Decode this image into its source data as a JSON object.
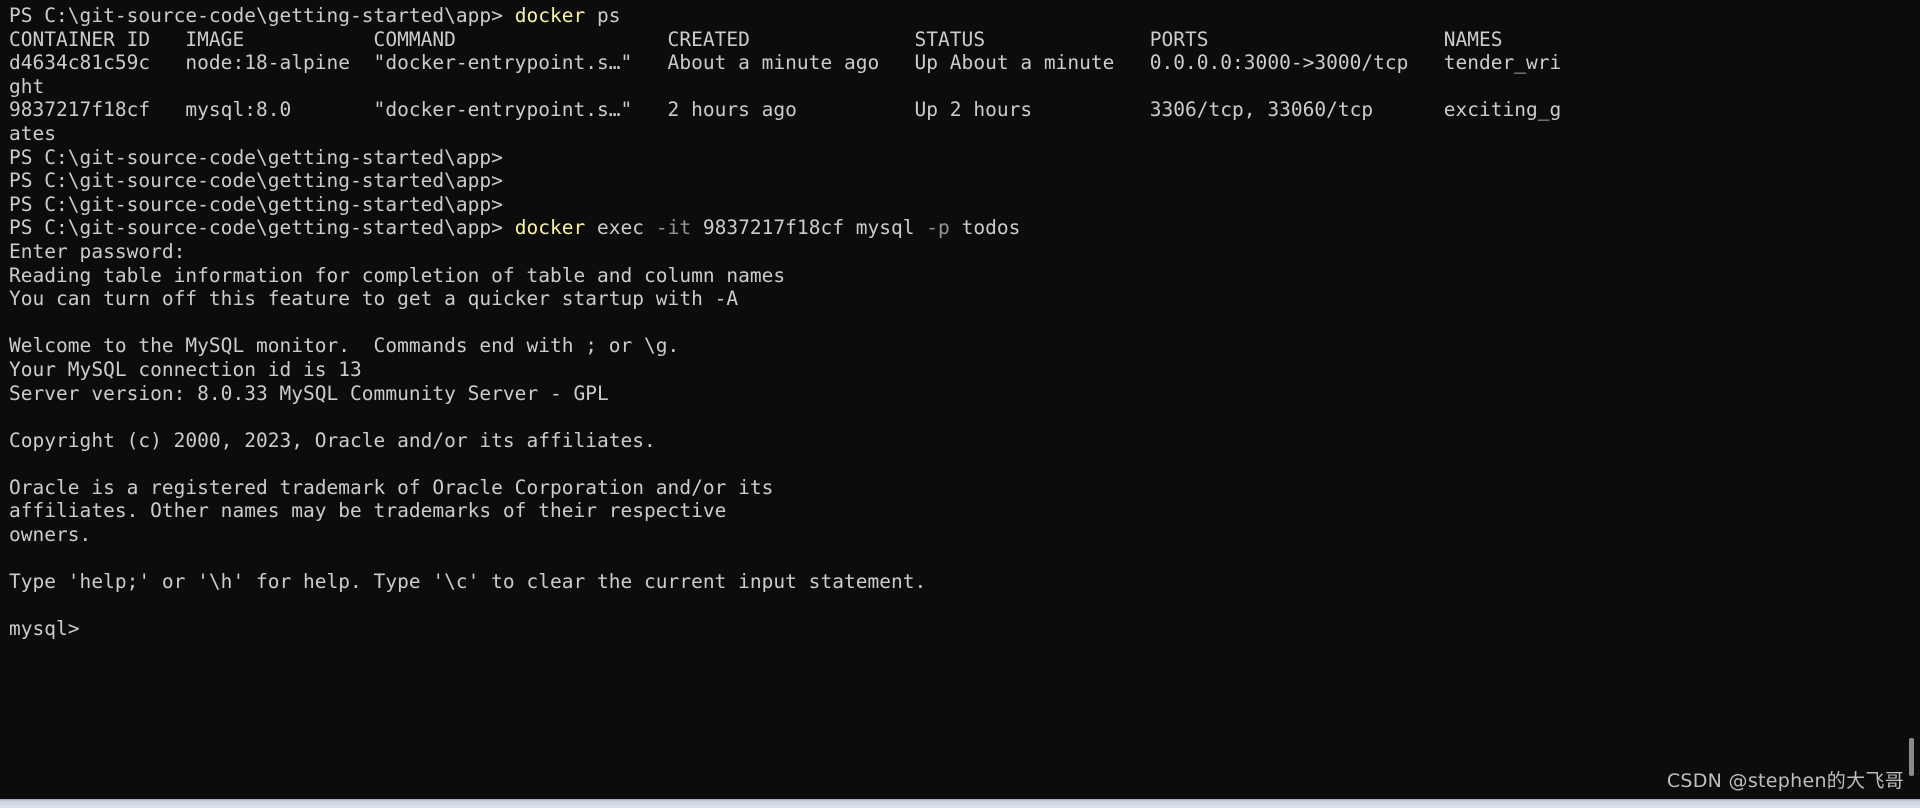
{
  "terminal": {
    "shell": "PowerShell",
    "prompt": "PS C:\\git-source-code\\getting-started\\app>",
    "background_color": "#0c0c0c",
    "foreground_color": "#cccccc",
    "command_color": "#f9f1a5",
    "parameter_color": "#949494",
    "cursor_line": "mysql>",
    "lines": [
      {
        "id": "line-01-prompt-docker-ps",
        "segments": [
          {
            "text": "PS C:\\git-source-code\\getting-started\\app> ",
            "style": "plain"
          },
          {
            "text": "docker",
            "style": "cmd"
          },
          {
            "text": " ps",
            "style": "plain"
          }
        ]
      },
      {
        "id": "line-02-ps-table-header",
        "segments": [
          {
            "text": "CONTAINER ID   IMAGE           COMMAND                  CREATED              STATUS              PORTS                    NAMES",
            "style": "plain"
          }
        ]
      },
      {
        "id": "line-03-ps-row-1",
        "segments": [
          {
            "text": "d4634c81c59c   node:18-alpine  \"docker-entrypoint.s…\"   About a minute ago   Up About a minute   0.0.0.0:3000->3000/tcp   tender_wri",
            "style": "plain"
          }
        ]
      },
      {
        "id": "line-04-ps-row-1-wrap",
        "segments": [
          {
            "text": "ght",
            "style": "plain"
          }
        ]
      },
      {
        "id": "line-05-ps-row-2",
        "segments": [
          {
            "text": "9837217f18cf   mysql:8.0       \"docker-entrypoint.s…\"   2 hours ago          Up 2 hours          3306/tcp, 33060/tcp      exciting_g",
            "style": "plain"
          }
        ]
      },
      {
        "id": "line-06-ps-row-2-wrap",
        "segments": [
          {
            "text": "ates",
            "style": "plain"
          }
        ]
      },
      {
        "id": "line-07-empty-prompt-1",
        "segments": [
          {
            "text": "PS C:\\git-source-code\\getting-started\\app>",
            "style": "plain"
          }
        ]
      },
      {
        "id": "line-08-empty-prompt-2",
        "segments": [
          {
            "text": "PS C:\\git-source-code\\getting-started\\app>",
            "style": "plain"
          }
        ]
      },
      {
        "id": "line-09-empty-prompt-3",
        "segments": [
          {
            "text": "PS C:\\git-source-code\\getting-started\\app>",
            "style": "plain"
          }
        ]
      },
      {
        "id": "line-10-prompt-docker-exec",
        "segments": [
          {
            "text": "PS C:\\git-source-code\\getting-started\\app> ",
            "style": "plain"
          },
          {
            "text": "docker",
            "style": "cmd"
          },
          {
            "text": " exec ",
            "style": "plain"
          },
          {
            "text": "-it",
            "style": "param"
          },
          {
            "text": " 9837217f18cf mysql ",
            "style": "plain"
          },
          {
            "text": "-p",
            "style": "param"
          },
          {
            "text": " todos",
            "style": "plain"
          }
        ]
      },
      {
        "id": "line-11-enter-password",
        "segments": [
          {
            "text": "Enter password:",
            "style": "plain"
          }
        ]
      },
      {
        "id": "line-12-reading-table-info",
        "segments": [
          {
            "text": "Reading table information for completion of table and column names",
            "style": "plain"
          }
        ]
      },
      {
        "id": "line-13-turn-off-feature",
        "segments": [
          {
            "text": "You can turn off this feature to get a quicker startup with -A",
            "style": "plain"
          }
        ]
      },
      {
        "id": "line-14-blank",
        "segments": [
          {
            "text": "",
            "style": "plain"
          }
        ]
      },
      {
        "id": "line-15-welcome",
        "segments": [
          {
            "text": "Welcome to the MySQL monitor.  Commands end with ; or \\g.",
            "style": "plain"
          }
        ]
      },
      {
        "id": "line-16-connection-id",
        "segments": [
          {
            "text": "Your MySQL connection id is 13",
            "style": "plain"
          }
        ]
      },
      {
        "id": "line-17-server-version",
        "segments": [
          {
            "text": "Server version: 8.0.33 MySQL Community Server - GPL",
            "style": "plain"
          }
        ]
      },
      {
        "id": "line-18-blank",
        "segments": [
          {
            "text": "",
            "style": "plain"
          }
        ]
      },
      {
        "id": "line-19-copyright",
        "segments": [
          {
            "text": "Copyright (c) 2000, 2023, Oracle and/or its affiliates.",
            "style": "plain"
          }
        ]
      },
      {
        "id": "line-20-blank",
        "segments": [
          {
            "text": "",
            "style": "plain"
          }
        ]
      },
      {
        "id": "line-21-trademark-1",
        "segments": [
          {
            "text": "Oracle is a registered trademark of Oracle Corporation and/or its",
            "style": "plain"
          }
        ]
      },
      {
        "id": "line-22-trademark-2",
        "segments": [
          {
            "text": "affiliates. Other names may be trademarks of their respective",
            "style": "plain"
          }
        ]
      },
      {
        "id": "line-23-trademark-3",
        "segments": [
          {
            "text": "owners.",
            "style": "plain"
          }
        ]
      },
      {
        "id": "line-24-blank",
        "segments": [
          {
            "text": "",
            "style": "plain"
          }
        ]
      },
      {
        "id": "line-25-help-hint",
        "segments": [
          {
            "text": "Type 'help;' or '\\h' for help. Type '\\c' to clear the current input statement.",
            "style": "plain"
          }
        ]
      },
      {
        "id": "line-26-blank",
        "segments": [
          {
            "text": "",
            "style": "plain"
          }
        ]
      },
      {
        "id": "line-27-mysql-prompt",
        "segments": [
          {
            "text": "mysql>",
            "style": "plain"
          }
        ]
      }
    ],
    "docker_ps_table": {
      "columns": [
        "CONTAINER ID",
        "IMAGE",
        "COMMAND",
        "CREATED",
        "STATUS",
        "PORTS",
        "NAMES"
      ],
      "rows": [
        {
          "container_id": "d4634c81c59c",
          "image": "node:18-alpine",
          "command": "\"docker-entrypoint.s…\"",
          "created": "About a minute ago",
          "status": "Up About a minute",
          "ports": "0.0.0.0:3000->3000/tcp",
          "names": "tender_wright"
        },
        {
          "container_id": "9837217f18cf",
          "image": "mysql:8.0",
          "command": "\"docker-entrypoint.s…\"",
          "created": "2 hours ago",
          "status": "Up 2 hours",
          "ports": "3306/tcp, 33060/tcp",
          "names": "exciting_gates"
        }
      ]
    }
  },
  "scrollbar": {
    "label": "vertical-scrollbar"
  },
  "watermark": {
    "text": "CSDN @stephen的大飞哥"
  }
}
